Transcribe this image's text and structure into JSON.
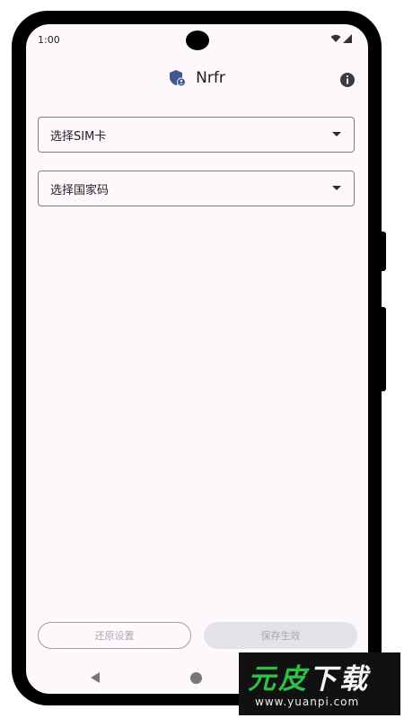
{
  "status_bar": {
    "time": "1:00"
  },
  "app": {
    "title": "Nrfr"
  },
  "form": {
    "sim_select_label": "选择SIM卡",
    "country_select_label": "选择国家码"
  },
  "actions": {
    "reset_label": "还原设置",
    "save_label": "保存生效"
  },
  "icons": {
    "app_logo": "shield-icon",
    "info": "info-icon",
    "wifi": "wifi-icon",
    "signal": "signal-icon",
    "back": "nav-back-icon",
    "home": "nav-home-icon"
  },
  "watermark": {
    "brand_part1": "元皮",
    "brand_part2": "下载",
    "url": "www.yuanpi.com"
  },
  "colors": {
    "screen_bg": "#fdf8fc",
    "logo_blue": "#3f5a8f",
    "watermark_green": "#2fbf46"
  }
}
